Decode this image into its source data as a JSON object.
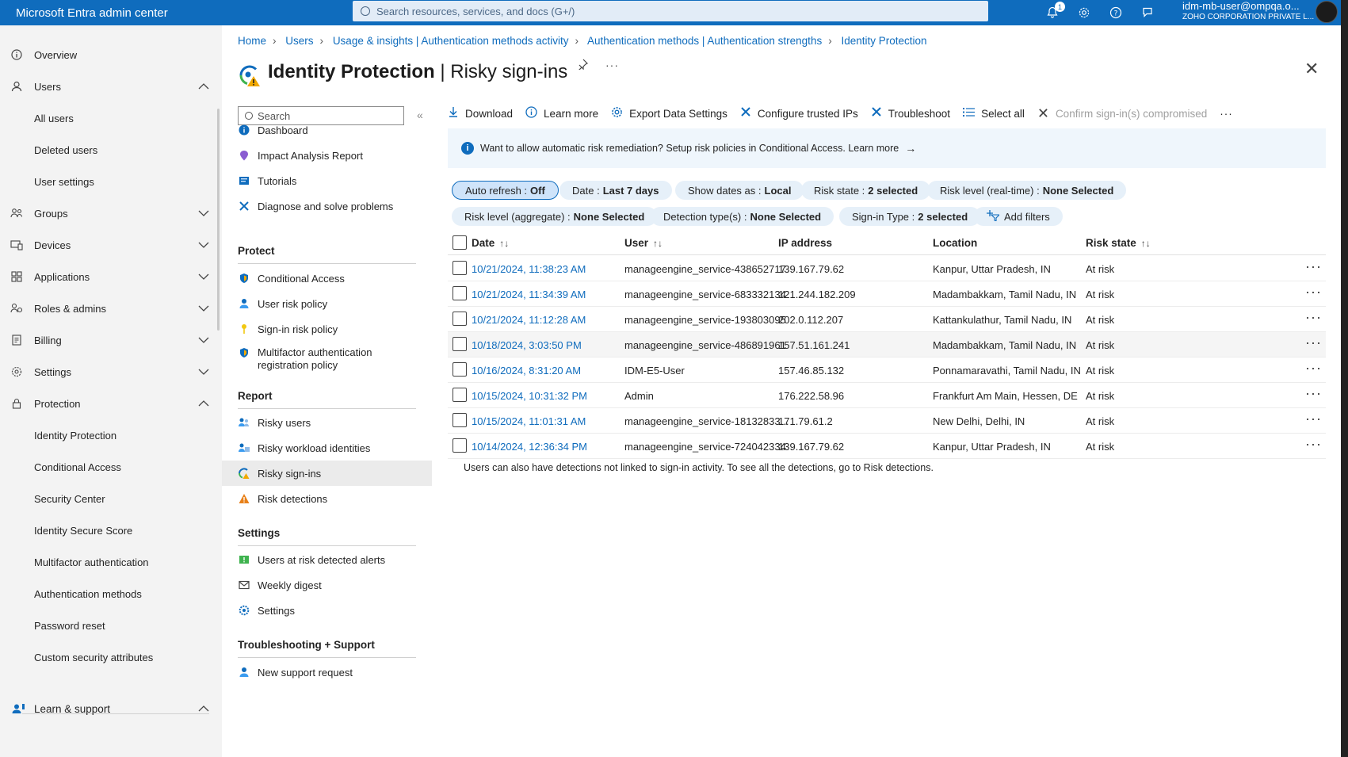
{
  "topbar": {
    "brand": "Microsoft Entra admin center",
    "search_placeholder": "Search resources, services, and docs (G+/)",
    "notification_count": "1",
    "account_name": "idm-mb-user@ompqa.o...",
    "account_org": "ZOHO CORPORATION PRIVATE L..."
  },
  "leftnav": {
    "items": [
      {
        "label": "Overview",
        "icon": "info-icon"
      },
      {
        "label": "Users",
        "icon": "person-icon",
        "chevron": "up"
      },
      {
        "label": "All users",
        "sub": true
      },
      {
        "label": "Deleted users",
        "sub": true
      },
      {
        "label": "User settings",
        "sub": true
      },
      {
        "label": "Groups",
        "icon": "groups-icon",
        "chevron": "down"
      },
      {
        "label": "Devices",
        "icon": "devices-icon",
        "chevron": "down"
      },
      {
        "label": "Applications",
        "icon": "apps-icon",
        "chevron": "down"
      },
      {
        "label": "Roles & admins",
        "icon": "roles-icon",
        "chevron": "down"
      },
      {
        "label": "Billing",
        "icon": "billing-icon",
        "chevron": "down"
      },
      {
        "label": "Settings",
        "icon": "gear-icon",
        "chevron": "down"
      },
      {
        "label": "Protection",
        "icon": "lock-icon",
        "chevron": "up"
      },
      {
        "label": "Identity Protection",
        "sub": true
      },
      {
        "label": "Conditional Access",
        "sub": true
      },
      {
        "label": "Security Center",
        "sub": true
      },
      {
        "label": "Identity Secure Score",
        "sub": true
      },
      {
        "label": "Multifactor authentication",
        "sub": true
      },
      {
        "label": "Authentication methods",
        "sub": true
      },
      {
        "label": "Password reset",
        "sub": true
      },
      {
        "label": "Custom security attributes",
        "sub": true
      }
    ],
    "learn_support": "Learn & support"
  },
  "breadcrumb": [
    "Home",
    "Users",
    "Usage & insights | Authentication methods activity",
    "Authentication methods | Authentication strengths",
    "Identity Protection"
  ],
  "page": {
    "title_main": "Identity Protection",
    "title_sep": " | ",
    "title_sub": "Risky sign-ins"
  },
  "menu": {
    "search_placeholder": "Search",
    "top_items": [
      "Dashboard",
      "Impact Analysis Report",
      "Tutorials",
      "Diagnose and solve problems"
    ],
    "protect_header": "Protect",
    "protect_items": [
      "Conditional Access",
      "User risk policy",
      "Sign-in risk policy",
      "Multifactor authentication registration policy"
    ],
    "report_header": "Report",
    "report_items": [
      "Risky users",
      "Risky workload identities",
      "Risky sign-ins",
      "Risk detections"
    ],
    "settings_header": "Settings",
    "settings_items": [
      "Users at risk detected alerts",
      "Weekly digest",
      "Settings"
    ],
    "support_header": "Troubleshooting + Support",
    "support_items": [
      "New support request"
    ]
  },
  "commands": {
    "download": "Download",
    "learn_more": "Learn more",
    "export": "Export Data Settings",
    "trusted_ips": "Configure trusted IPs",
    "troubleshoot": "Troubleshoot",
    "select_all": "Select all",
    "confirm": "Confirm sign-in(s) compromised"
  },
  "info": {
    "text": "Want to allow automatic risk remediation? Setup risk policies in Conditional Access. Learn more"
  },
  "filters": {
    "auto_refresh": {
      "label": "Auto refresh :",
      "value": "Off"
    },
    "date": {
      "label": "Date :",
      "value": "Last 7 days"
    },
    "show_dates": {
      "label": "Show dates as :",
      "value": "Local"
    },
    "risk_state": {
      "label": "Risk state :",
      "value": "2 selected"
    },
    "risk_level_rt": {
      "label": "Risk level (real-time) :",
      "value": "None Selected"
    },
    "risk_level_agg": {
      "label": "Risk level (aggregate) :",
      "value": "None Selected"
    },
    "detection": {
      "label": "Detection type(s) :",
      "value": "None Selected"
    },
    "signin_type": {
      "label": "Sign-in Type :",
      "value": "2 selected"
    },
    "add_filters": "Add filters"
  },
  "table": {
    "columns": {
      "date": "Date",
      "user": "User",
      "ip": "IP address",
      "location": "Location",
      "risk_state": "Risk state"
    },
    "rows": [
      {
        "date": "10/21/2024, 11:38:23 AM",
        "user": "manageengine_service-438652717",
        "ip": "139.167.79.62",
        "location": "Kanpur, Uttar Pradesh, IN",
        "risk_state": "At risk"
      },
      {
        "date": "10/21/2024, 11:34:39 AM",
        "user": "manageengine_service-683332134",
        "ip": "121.244.182.209",
        "location": "Madambakkam, Tamil Nadu, IN",
        "risk_state": "At risk"
      },
      {
        "date": "10/21/2024, 11:12:28 AM",
        "user": "manageengine_service-193803095",
        "ip": "202.0.112.207",
        "location": "Kattankulathur, Tamil Nadu, IN",
        "risk_state": "At risk"
      },
      {
        "date": "10/18/2024, 3:03:50 PM",
        "user": "manageengine_service-486891961",
        "ip": "157.51.161.241",
        "location": "Madambakkam, Tamil Nadu, IN",
        "risk_state": "At risk"
      },
      {
        "date": "10/16/2024, 8:31:20 AM",
        "user": "IDM-E5-User",
        "ip": "157.46.85.132",
        "location": "Ponnamaravathi, Tamil Nadu, IN",
        "risk_state": "At risk"
      },
      {
        "date": "10/15/2024, 10:31:32 PM",
        "user": "Admin",
        "ip": "176.222.58.96",
        "location": "Frankfurt Am Main, Hessen, DE",
        "risk_state": "At risk"
      },
      {
        "date": "10/15/2024, 11:01:31 AM",
        "user": "manageengine_service-18132833...",
        "ip": "171.79.61.2",
        "location": "New Delhi, Delhi, IN",
        "risk_state": "At risk"
      },
      {
        "date": "10/14/2024, 12:36:34 PM",
        "user": "manageengine_service-724042334",
        "ip": "139.167.79.62",
        "location": "Kanpur, Uttar Pradesh, IN",
        "risk_state": "At risk"
      }
    ],
    "footnote": "Users can also have detections not linked to sign-in activity. To see all the detections, go to Risk detections."
  },
  "colors": {
    "accent": "#0f6cbd",
    "nav_bg": "#f3f3f3",
    "info_bg": "#eff6fc"
  }
}
